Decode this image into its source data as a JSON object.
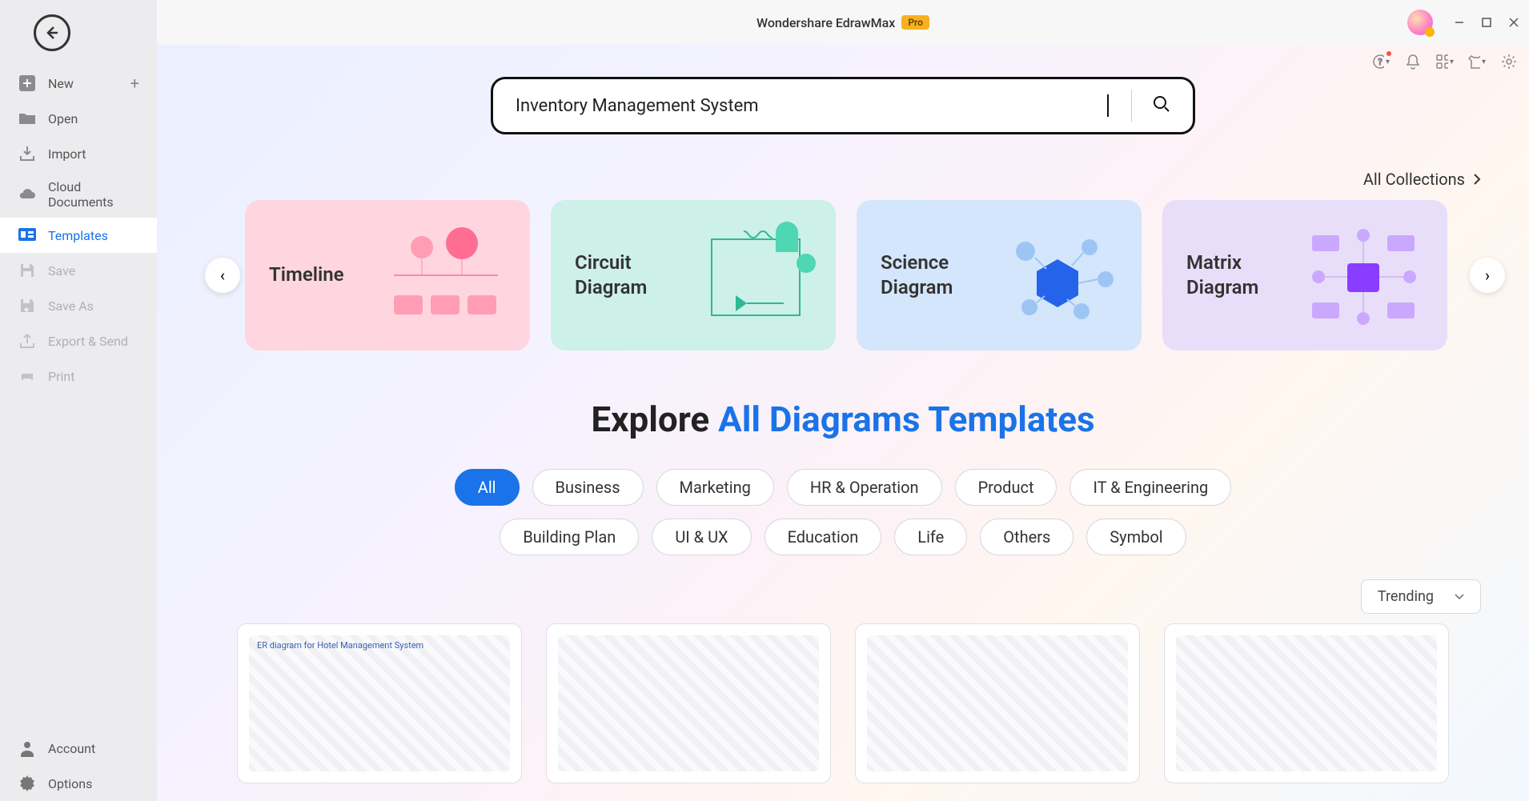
{
  "app": {
    "title": "Wondershare EdrawMax",
    "badge": "Pro"
  },
  "sidebar": {
    "back": "Back",
    "items": [
      {
        "label": "New",
        "icon": "plus-box",
        "hasPlus": true
      },
      {
        "label": "Open",
        "icon": "folder"
      },
      {
        "label": "Import",
        "icon": "import"
      },
      {
        "label": "Cloud Documents",
        "icon": "cloud"
      },
      {
        "label": "Templates",
        "icon": "templates",
        "active": true
      },
      {
        "label": "Save",
        "icon": "save",
        "disabled": true
      },
      {
        "label": "Save As",
        "icon": "save-as",
        "disabled": true
      },
      {
        "label": "Export & Send",
        "icon": "export",
        "disabled": true
      },
      {
        "label": "Print",
        "icon": "print",
        "disabled": true
      }
    ],
    "bottom": [
      {
        "label": "Account",
        "icon": "account"
      },
      {
        "label": "Options",
        "icon": "gear"
      }
    ]
  },
  "search": {
    "value": "Inventory Management System"
  },
  "collections_link": "All Collections",
  "carousel": [
    {
      "title": "Timeline"
    },
    {
      "title": "Circuit Diagram"
    },
    {
      "title": "Science Diagram"
    },
    {
      "title": "Matrix Diagram"
    }
  ],
  "explore": {
    "prefix": "Explore ",
    "highlight": "All Diagrams Templates"
  },
  "filters": [
    "All",
    "Business",
    "Marketing",
    "HR & Operation",
    "Product",
    "IT & Engineering",
    "Building Plan",
    "UI & UX",
    "Education",
    "Life",
    "Others",
    "Symbol"
  ],
  "active_filter": "All",
  "sort": {
    "selected": "Trending"
  },
  "results": [
    {
      "title": "ER diagram for Hotel Management System"
    },
    {
      "title": ""
    },
    {
      "title": ""
    },
    {
      "title": ""
    }
  ]
}
